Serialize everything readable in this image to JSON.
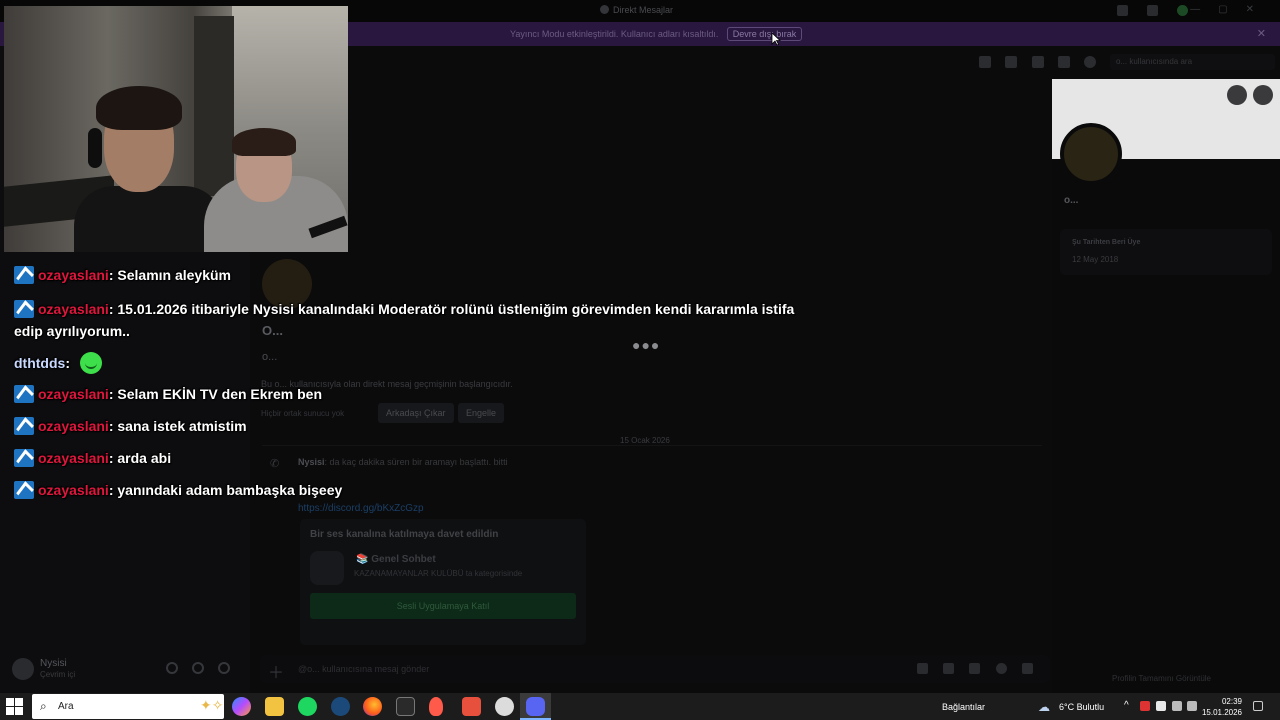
{
  "discord": {
    "window_title": "Direkt Mesajlar",
    "banner": {
      "message": "Yayıncı Modu etkinleştirildi. Kullanıcı adları kısaltıldı.",
      "disable_button": "Devre dışı bırak"
    },
    "header": {
      "search_placeholder": "o... kullanıcısında ara"
    },
    "user_panel": {
      "name": "Nysisi",
      "status": "Çevrim içi"
    },
    "chat": {
      "profile_name": "O...",
      "profile_username": "o...",
      "intro_text": "Bu o... kullanıcısıyla olan direkt mesaj geçmişinin başlangıcıdır.",
      "no_common_servers": "Hiçbir ortak sunucu yok",
      "remove_friend_button": "Arkadaşı Çıkar",
      "block_button": "Engelle",
      "date_divider": "15 Ocak 2026",
      "call_author": "Nysisi",
      "call_text": "da kaç dakika süren bir aramayı başlattı. bitti",
      "invite_link": "https://discord.gg/bKxZcGzp",
      "invite": {
        "heading": "Bir ses kanalına katılmaya davet edildin",
        "channel": "📚 Genel Sohbet",
        "server": "KAZANAMAYANLAR KULÜBÜ ta kategorisinde",
        "join_button": "Sesli Uygulamaya Katıl"
      },
      "composer_placeholder": "@o... kullanıcısına mesaj gönder"
    },
    "profile": {
      "name": "o...",
      "member_since_label": "Şu Tarihten Beri Üye",
      "member_since_value": "12 May 2018",
      "view_full_profile": "Profilin Tamamını Görüntüle"
    }
  },
  "stream_chat": {
    "messages": [
      {
        "user": "ozayaslani",
        "text": "Selamın aleyküm",
        "badge": true
      },
      {
        "user": "ozayaslani",
        "text": "15.01.2026 itibariyle Nysisi kanalındaki Moderatör rolünü üstleniğim görevimden kendi kararımla istifa edip ayrılıyorum..",
        "badge": true
      },
      {
        "user": "dthtdds",
        "text": "",
        "emote": "green-smile-emote",
        "badge": false
      },
      {
        "user": "ozayaslani",
        "text": "Selam EKİN TV den Ekrem ben",
        "badge": true
      },
      {
        "user": "ozayaslani",
        "text": "sana istek atmistim",
        "badge": true
      },
      {
        "user": "ozayaslani",
        "text": "arda abi",
        "badge": true
      },
      {
        "user": "ozayaslani",
        "text": "yanındaki adam bambaşka bişeey",
        "badge": true
      }
    ]
  },
  "taskbar": {
    "search_text": "Ara",
    "network_label": "Bağlantılar",
    "weather": "6°C  Bulutlu",
    "time": "02:39",
    "date": "15.01.2026",
    "apps": [
      "copilot-icon",
      "file-explorer-icon",
      "spotify-icon",
      "steam-icon",
      "firefox-icon",
      "epic-games-icon",
      "microphone-app-icon",
      "twitch-app-icon",
      "obs-icon",
      "discord-icon"
    ]
  },
  "colors": {
    "streamer_mode_banner": "#2a1740",
    "chat_username_red": "#e0163d",
    "moderator_badge": "#1f74c2",
    "taskbar": "#1c1c1c"
  }
}
